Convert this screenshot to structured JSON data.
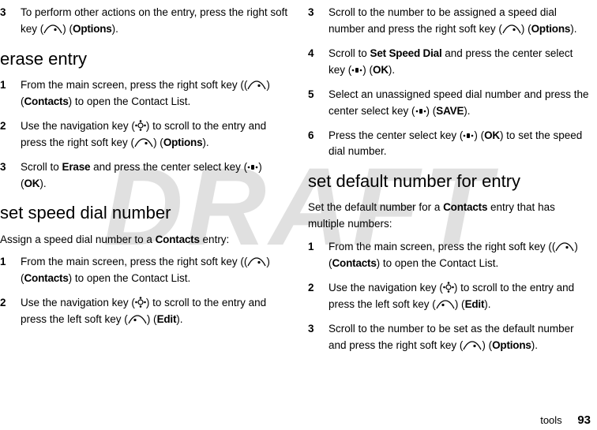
{
  "watermark": "DRAFT",
  "footer": {
    "section": "tools",
    "page": "93"
  },
  "left": {
    "topStep": {
      "num": "3",
      "a": "To perform other actions on the entry, press the right soft key (",
      "b": ") (",
      "opt": "Options",
      "c": ")."
    },
    "erase": {
      "heading": "erase entry",
      "s1": {
        "num": "1",
        "a": "From the main screen, press the right soft key (",
        "b": ") (",
        "opt": "Contacts",
        "c": ") to open the Contact List."
      },
      "s2": {
        "num": "2",
        "a": "Use the navigation key (",
        "b": ") to scroll to the entry and press the right soft key (",
        "c": ") (",
        "opt": "Options",
        "d": ")."
      },
      "s3": {
        "num": "3",
        "a": "Scroll to ",
        "erase": "Erase",
        "b": " and press the center select key (",
        "c": ") (",
        "ok": "OK",
        "d": ")."
      }
    },
    "speed": {
      "heading": "set speed dial number",
      "intro_a": "Assign a speed dial number to a ",
      "intro_b": "Contacts",
      "intro_c": " entry:",
      "s1": {
        "num": "1",
        "a": "From the main screen, press the right soft key (",
        "b": ") (",
        "opt": "Contacts",
        "c": ") to open the Contact List."
      },
      "s2": {
        "num": "2",
        "a": "Use the navigation key (",
        "b": ") to scroll to the entry and press the left soft key (",
        "c": ") (",
        "opt": "Edit",
        "d": ")."
      }
    }
  },
  "right": {
    "s3": {
      "num": "3",
      "a": "Scroll to the number to be assigned a speed dial number and press the right soft key (",
      "b": ") (",
      "opt": "Options",
      "c": ")."
    },
    "s4": {
      "num": "4",
      "a": "Scroll to ",
      "ssd": "Set Speed Dial",
      "b": " and press the center select key (",
      "c": ") (",
      "ok": "OK",
      "d": ")."
    },
    "s5": {
      "num": "5",
      "a": "Select an unassigned speed dial number and press the center select key (",
      "b": ") (",
      "save": "SAVE",
      "c": ")."
    },
    "s6": {
      "num": "6",
      "a": "Press the center select key (",
      "b": ") (",
      "ok": "OK",
      "c": ") to set the speed dial number."
    },
    "default": {
      "heading": "set default number for entry",
      "intro_a": "Set the default number for a ",
      "intro_b": "Contacts",
      "intro_c": " entry that has multiple numbers:",
      "s1": {
        "num": "1",
        "a": "From the main screen, press the right soft key (",
        "b": ") (",
        "opt": "Contacts",
        "c": ") to open the Contact List."
      },
      "s2": {
        "num": "2",
        "a": "Use the navigation key (",
        "b": ") to scroll to the entry and press the left soft key (",
        "c": ") (",
        "opt": "Edit",
        "d": ")."
      },
      "s3": {
        "num": "3",
        "a": "Scroll to the number to be set as the default number and press the right soft key (",
        "b": ") (",
        "opt": "Options",
        "c": ")."
      }
    }
  }
}
